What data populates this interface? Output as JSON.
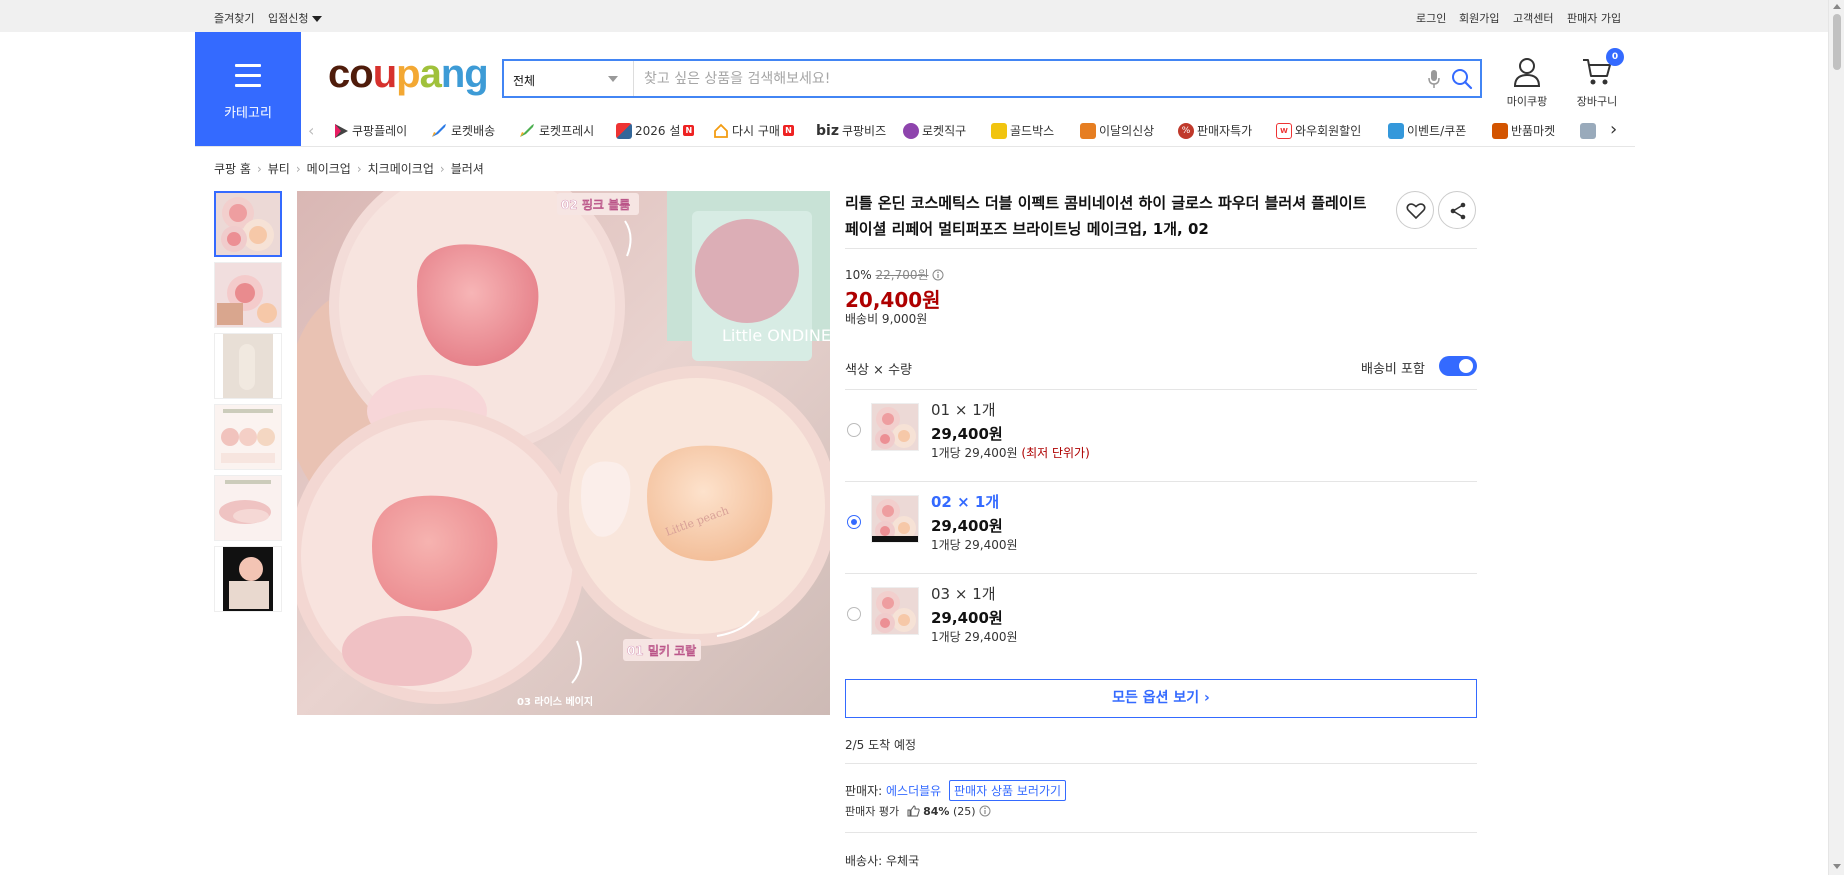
{
  "topbar": {
    "favorites": "즐겨찾기",
    "seller_apply": "입점신청",
    "login": "로그인",
    "signup": "회원가입",
    "customer_center": "고객센터",
    "seller_signup": "판매자 가입"
  },
  "header": {
    "category_label": "카테고리",
    "logo_text": "coupang",
    "search_category": "전체",
    "search_placeholder": "찾고 싶은 상품을 검색해보세요!",
    "my_coupang": "마이쿠팡",
    "cart": "장바구니",
    "cart_count": "0"
  },
  "nav": {
    "items": [
      {
        "label": "쿠팡플레이"
      },
      {
        "label": "로켓배송"
      },
      {
        "label": "로켓프레시"
      },
      {
        "label": "2026 설"
      },
      {
        "label": "다시 구매"
      },
      {
        "label": "쿠팡비즈",
        "prefix": "biz"
      },
      {
        "label": "로켓직구"
      },
      {
        "label": "골드박스"
      },
      {
        "label": "이달의신상"
      },
      {
        "label": "판매자특가"
      },
      {
        "label": "와우회원할인"
      },
      {
        "label": "이벤트/쿠폰"
      },
      {
        "label": "반품마켓"
      }
    ],
    "new_badge": "N"
  },
  "breadcrumb": [
    "쿠팡 홈",
    "뷰티",
    "메이크업",
    "치크메이크업",
    "블러셔"
  ],
  "product": {
    "title": "리틀 온딘 코스메틱스 더블 이펙트 콤비네이션 하이 글로스 파우더 블러셔 플레이트 페이셜 리페어 멀티퍼포즈 브라이트닝 메이크업, 1개, 02",
    "discount_rate": "10%",
    "original_price": "22,700원",
    "price": "20,400원",
    "shipping_fee": "배송비 9,000원",
    "image_labels": {
      "label_02": "02 핑크 블룸",
      "label_01": "01 밀키 코랄",
      "label_03": "03 라이스 베이지",
      "package_text": "Little ONDINE",
      "peach_text": "Little peach"
    }
  },
  "options": {
    "header_label": "색상 × 수량",
    "shipping_included": "배송비 포함",
    "items": [
      {
        "name": "01 × 1개",
        "price": "29,400원",
        "unit": "1개당 29,400원",
        "note": "(최저 단위가)",
        "selected": false
      },
      {
        "name": "02 × 1개",
        "price": "29,400원",
        "unit": "1개당 29,400원",
        "note": "",
        "selected": true
      },
      {
        "name": "03 × 1개",
        "price": "29,400원",
        "unit": "1개당 29,400원",
        "note": "",
        "selected": false
      }
    ],
    "view_all": "모든 옵션 보기 ›"
  },
  "delivery": {
    "arrival": "2/5 도착 예정",
    "seller_label": "판매자:",
    "seller_name": "에스더블유",
    "seller_link": "판매자 상품 보러가기",
    "rating_label": "판매자 평가",
    "rating_percent": "84%",
    "rating_count": "(25)",
    "carrier_label": "배송사:",
    "carrier_name": "우체국"
  },
  "colors": {
    "brand_blue": "#346aff",
    "price_red": "#ae0000"
  }
}
